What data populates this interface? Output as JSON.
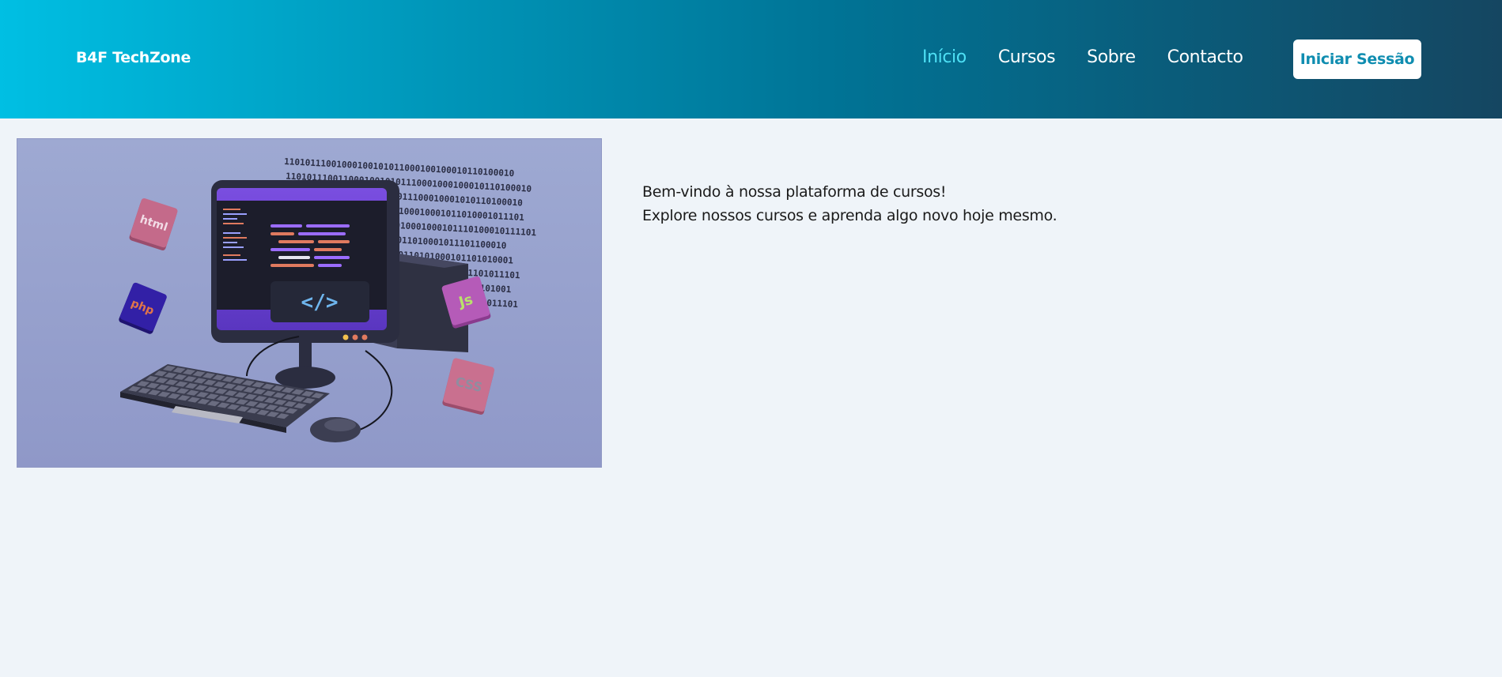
{
  "header": {
    "brand": "B4F TechZone",
    "nav": [
      {
        "label": "Início",
        "active": true
      },
      {
        "label": "Cursos",
        "active": false
      },
      {
        "label": "Sobre",
        "active": false
      },
      {
        "label": "Contacto",
        "active": false
      }
    ],
    "login_label": "Iniciar Sessão"
  },
  "hero": {
    "image_label": "computer-illustration",
    "tags": [
      "html",
      "php",
      "Js",
      "CSS"
    ],
    "code_symbol": "</>",
    "binary_lines": [
      "11010111001000100101011000100100010110100010",
      "11010111001100010010101110001000100010110100010",
      "110101110011000100101011100010001010110100010",
      "110101110011000100100100010001011010001011101",
      "11010111001100010010010001000101110100010111101",
      "11010111001100010001011010001011101100010",
      "110101110011000100010110101000101101010001",
      "1101011100110001000101101010001011101011101",
      "11010111001100010001011010100010110101001",
      "110101110011000100010110101000101101011101"
    ]
  },
  "main": {
    "line1": "Bem-vindo à nossa plataforma de cursos!",
    "line2": "Explore nossos cursos e aprenda algo novo hoje mesmo."
  },
  "colors": {
    "header_gradient_start": "#00bfe3",
    "header_gradient_end": "#154661",
    "nav_active": "#4ee0f5",
    "page_background": "#eff4f9",
    "button_text": "#0f8db0"
  }
}
